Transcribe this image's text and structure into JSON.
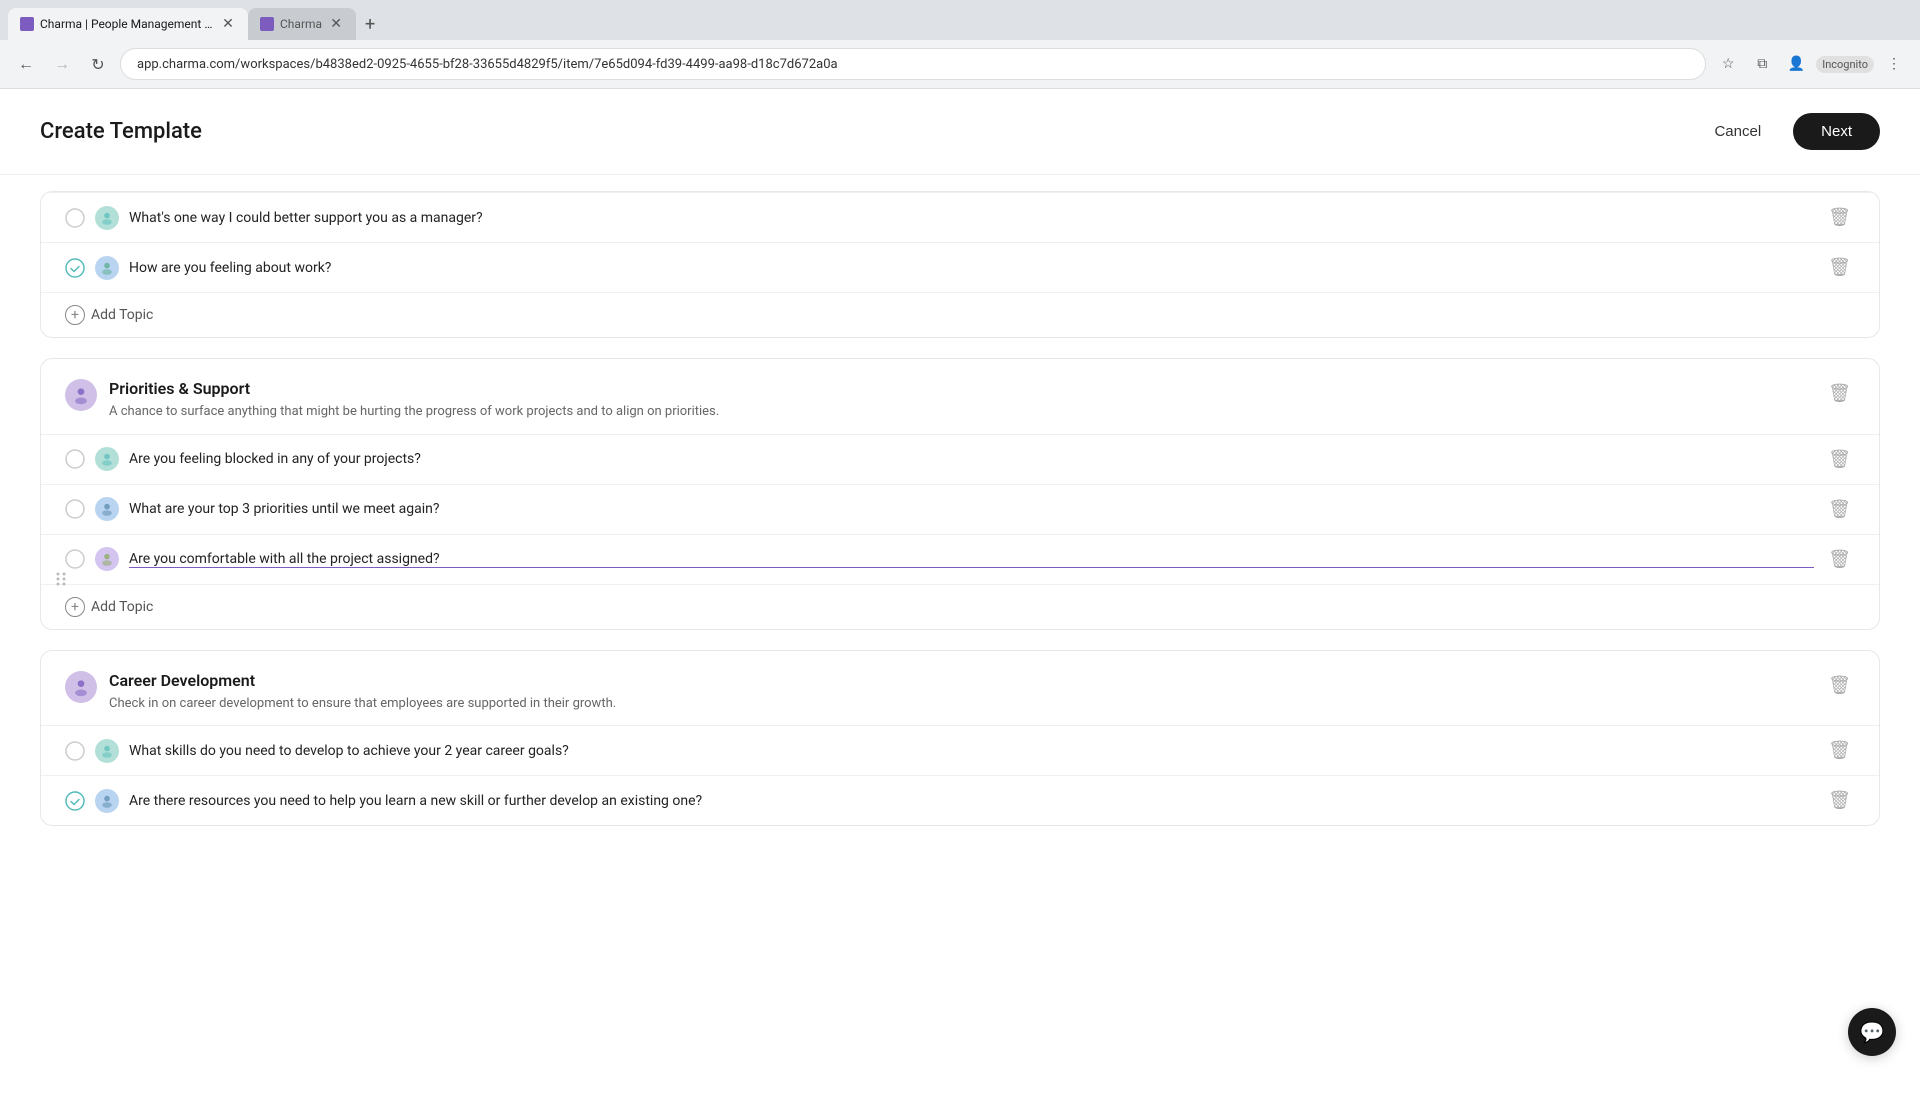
{
  "browser": {
    "tabs": [
      {
        "id": "tab1",
        "title": "Charma | People Management S...",
        "favicon_type": "charma",
        "active": true
      },
      {
        "id": "tab2",
        "title": "Charma",
        "favicon_type": "charma",
        "active": false
      }
    ],
    "address": "app.charma.com/workspaces/b4838ed2-0925-4655-bf28-33655d4829f5/item/7e65d094-fd39-4499-aa98-d18c7d672a0a",
    "incognito_label": "Incognito"
  },
  "header": {
    "title": "Create Template",
    "cancel_label": "Cancel",
    "next_label": "Next"
  },
  "sections": [
    {
      "id": "partial",
      "questions": [
        {
          "text": "What's one way I could better support you as a manager?",
          "avatar_type": "teal",
          "checked": false
        },
        {
          "text": "How are you feeling about work?",
          "avatar_type": "blue",
          "checked": true
        }
      ],
      "add_topic_label": "Add Topic"
    },
    {
      "id": "priorities",
      "title": "Priorities & Support",
      "description": "A chance to surface anything that might be hurting the progress of work projects and to align on priorities.",
      "questions": [
        {
          "text": "Are you feeling blocked in any of your projects?",
          "avatar_type": "teal",
          "checked": false
        },
        {
          "text": "What are your top 3 priorities until we meet again?",
          "avatar_type": "blue",
          "checked": false
        },
        {
          "text": "Are you comfortable with all the project assigned?",
          "avatar_type": "purple",
          "checked": false,
          "editing": true
        }
      ],
      "add_topic_label": "Add Topic"
    },
    {
      "id": "career",
      "title": "Career Development",
      "description": "Check in on career development to ensure that employees are supported in their growth.",
      "questions": [
        {
          "text": "What skills do you need to develop to achieve your 2 year career goals?",
          "avatar_type": "teal",
          "checked": false
        },
        {
          "text": "Are there resources you need to help you learn a new skill or further develop an existing one?",
          "avatar_type": "blue",
          "checked": true
        }
      ],
      "add_topic_label": "Add Topic"
    }
  ]
}
